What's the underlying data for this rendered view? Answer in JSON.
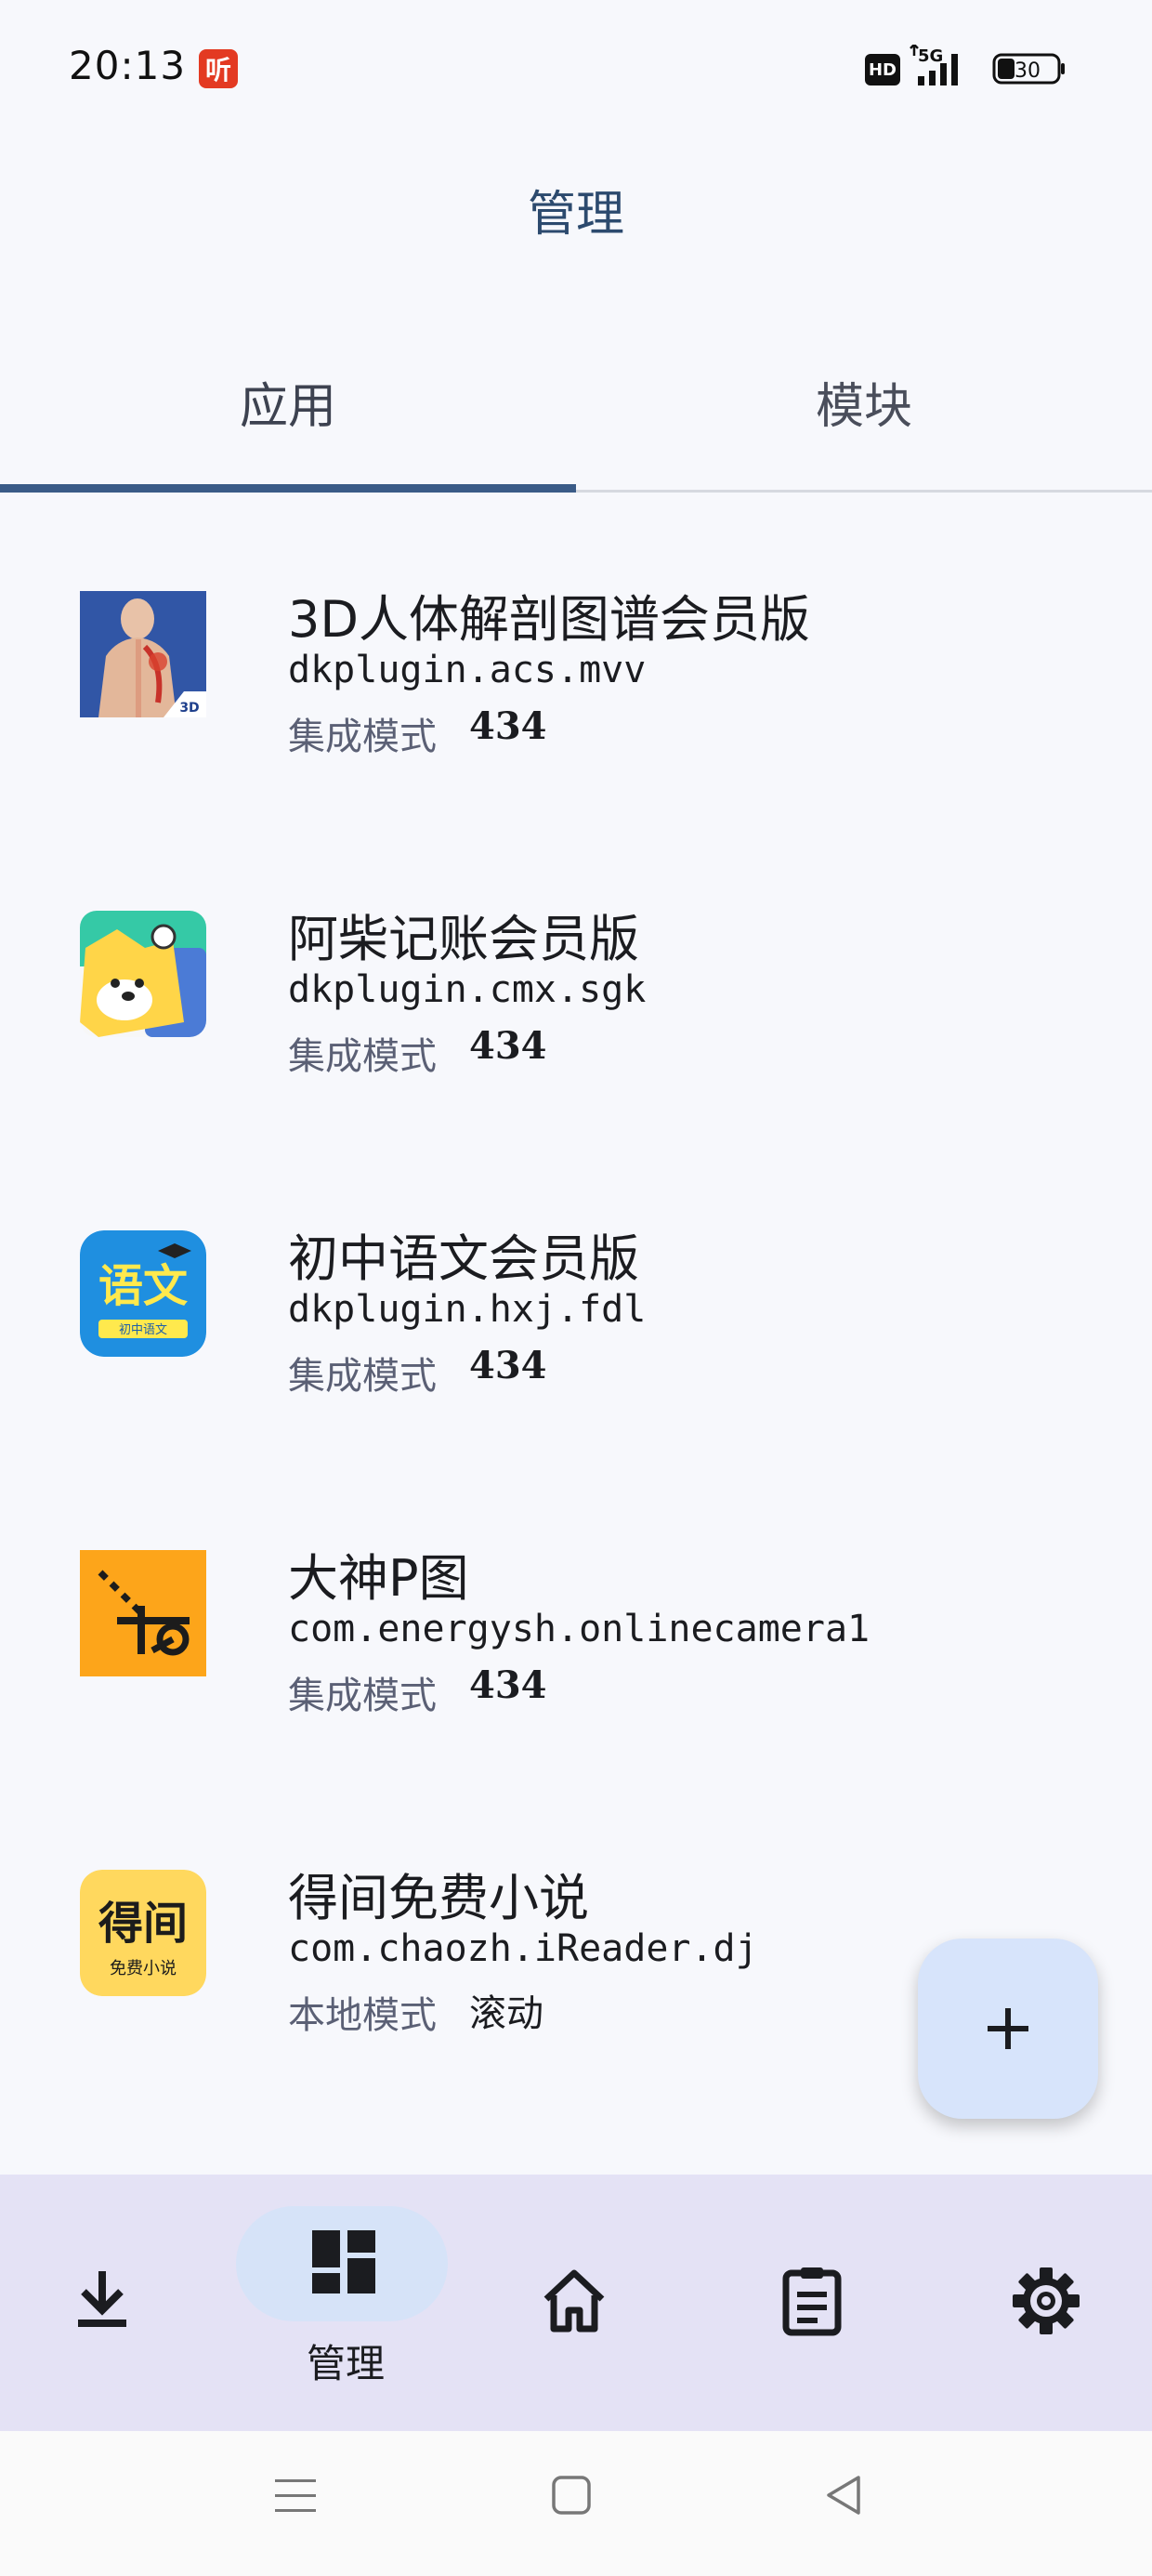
{
  "status_bar": {
    "time": "20:13",
    "app_badge": "听",
    "hd_label": "HD",
    "network": "5G",
    "battery": "30"
  },
  "header": {
    "title": "管理"
  },
  "tabs": [
    {
      "label": "应用",
      "active": true
    },
    {
      "label": "模块",
      "active": false
    }
  ],
  "apps": [
    {
      "name": "3D人体解剖图谱会员版",
      "package": "dkplugin.acs.mvv",
      "mode": "集成模式",
      "version": "434",
      "icon": "anatomy-3d-icon"
    },
    {
      "name": "阿柴记账会员版",
      "package": "dkplugin.cmx.sgk",
      "mode": "集成模式",
      "version": "434",
      "icon": "shiba-dog-icon"
    },
    {
      "name": "初中语文会员版",
      "package": "dkplugin.hxj.fdl",
      "mode": "集成模式",
      "version": "434",
      "icon": "chinese-language-icon"
    },
    {
      "name": "大神P图",
      "package": "com.energysh.onlinecamera1",
      "mode": "集成模式",
      "version": "434",
      "icon": "scissors-icon"
    },
    {
      "name": "得间免费小说",
      "package": "com.chaozh.iReader.dj",
      "mode": "本地模式",
      "version": "滚动",
      "icon": "dejian-novel-icon"
    }
  ],
  "app_icon_text": {
    "chinese_icon": "语文",
    "chinese_icon_sub": "初中语文",
    "novel_icon": "得间",
    "novel_icon_sub": "免费小说"
  },
  "fab": {
    "label": "+"
  },
  "bottom_nav": [
    {
      "id": "download",
      "icon": "download-icon",
      "label": ""
    },
    {
      "id": "manage",
      "icon": "dashboard-icon",
      "label": "管理",
      "active": true
    },
    {
      "id": "home",
      "icon": "home-icon",
      "label": ""
    },
    {
      "id": "logs",
      "icon": "clipboard-icon",
      "label": ""
    },
    {
      "id": "settings",
      "icon": "gear-icon",
      "label": ""
    }
  ],
  "colors": {
    "accent": "#3a5b87",
    "nav_background": "#e4e2f5",
    "fab_background": "#d7e4fb"
  }
}
